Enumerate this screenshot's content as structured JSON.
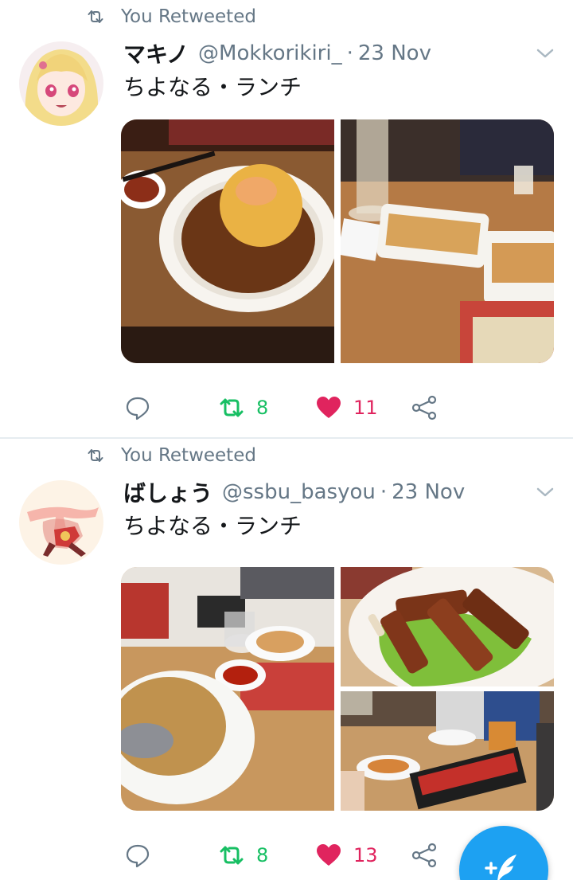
{
  "tweets": [
    {
      "retweet_label": "You Retweeted",
      "author_name": "マキノ",
      "author_handle": "@Mokkorikiri_",
      "separator": "·",
      "date": "23 Nov",
      "text": "ちよなる・ランチ",
      "retweet_count": "8",
      "like_count": "11",
      "photos": [
        "tenshindon-plate",
        "gyoza-plates"
      ]
    },
    {
      "retweet_label": "You Retweeted",
      "author_name": "ばしょう",
      "author_handle": "@ssbu_basyou",
      "separator": "·",
      "date": "23 Nov",
      "text": "ちよなる・ランチ",
      "retweet_count": "8",
      "like_count": "13",
      "photos": [
        "fried-rice-plate",
        "spare-ribs-plate",
        "restaurant-table"
      ]
    }
  ],
  "colors": {
    "retweet_green": "#17bf63",
    "like_red": "#e0245e",
    "meta_gray": "#657786",
    "fab_blue": "#1da1f2"
  },
  "icons": [
    "retweet-icon",
    "chevron-down-icon",
    "reply-icon",
    "heart-icon",
    "share-icon",
    "compose-tweet-icon"
  ]
}
